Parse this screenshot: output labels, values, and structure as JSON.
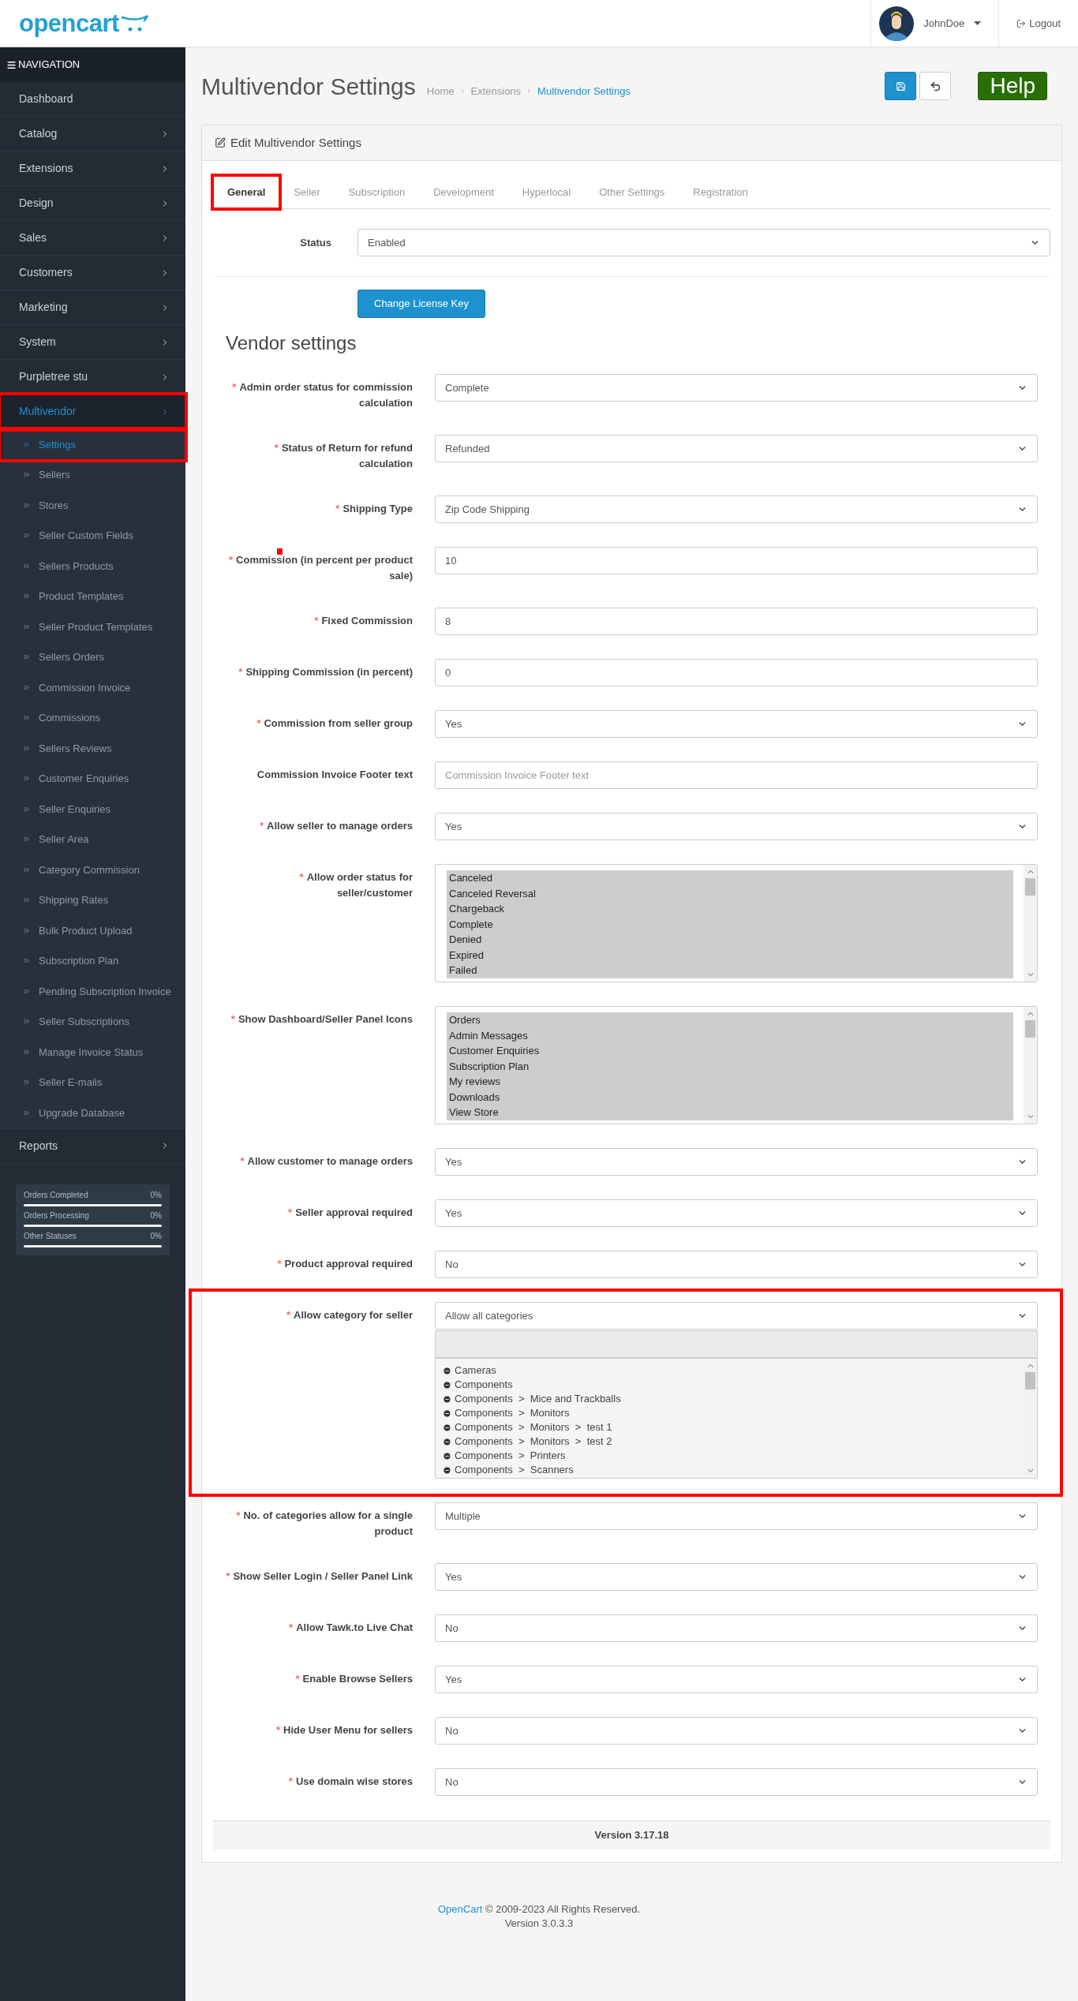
{
  "header": {
    "logo": "opencart",
    "user": "JohnDoe",
    "logout": "Logout"
  },
  "sidebar": {
    "heading": "NAVIGATION",
    "items": [
      {
        "label": "Dashboard",
        "has_children": false,
        "selected": false,
        "highlighted": false
      },
      {
        "label": "Catalog",
        "has_children": true,
        "selected": false,
        "highlighted": false
      },
      {
        "label": "Extensions",
        "has_children": true,
        "selected": false,
        "highlighted": false
      },
      {
        "label": "Design",
        "has_children": true,
        "selected": false,
        "highlighted": false
      },
      {
        "label": "Sales",
        "has_children": true,
        "selected": false,
        "highlighted": false
      },
      {
        "label": "Customers",
        "has_children": true,
        "selected": false,
        "highlighted": false
      },
      {
        "label": "Marketing",
        "has_children": true,
        "selected": false,
        "highlighted": false
      },
      {
        "label": "System",
        "has_children": true,
        "selected": false,
        "highlighted": false
      },
      {
        "label": "Purpletree stu",
        "has_children": true,
        "selected": false,
        "highlighted": false
      },
      {
        "label": "Multivendor",
        "has_children": true,
        "selected": true,
        "highlighted": true,
        "children": [
          {
            "label": "Settings",
            "selected": true,
            "highlighted": true
          },
          {
            "label": "Sellers",
            "selected": false,
            "highlighted": false
          },
          {
            "label": "Stores",
            "selected": false,
            "highlighted": false
          },
          {
            "label": "Seller Custom Fields",
            "selected": false,
            "highlighted": false
          },
          {
            "label": "Sellers Products",
            "selected": false,
            "highlighted": false
          },
          {
            "label": "Product Templates",
            "selected": false,
            "highlighted": false
          },
          {
            "label": "Seller Product Templates",
            "selected": false,
            "highlighted": false
          },
          {
            "label": "Sellers Orders",
            "selected": false,
            "highlighted": false
          },
          {
            "label": "Commission Invoice",
            "selected": false,
            "highlighted": false
          },
          {
            "label": "Commissions",
            "selected": false,
            "highlighted": false
          },
          {
            "label": "Sellers Reviews",
            "selected": false,
            "highlighted": false
          },
          {
            "label": "Customer Enquiries",
            "selected": false,
            "highlighted": false
          },
          {
            "label": "Seller Enquiries",
            "selected": false,
            "highlighted": false
          },
          {
            "label": "Seller Area",
            "selected": false,
            "highlighted": false
          },
          {
            "label": "Category Commission",
            "selected": false,
            "highlighted": false
          },
          {
            "label": "Shipping Rates",
            "selected": false,
            "highlighted": false
          },
          {
            "label": "Bulk Product Upload",
            "selected": false,
            "highlighted": false
          },
          {
            "label": "Subscription Plan",
            "selected": false,
            "highlighted": false
          },
          {
            "label": "Pending Subscription Invoice",
            "selected": false,
            "highlighted": false
          },
          {
            "label": "Seller Subscriptions",
            "selected": false,
            "highlighted": false
          },
          {
            "label": "Manage Invoice Status",
            "selected": false,
            "highlighted": false
          },
          {
            "label": "Seller E-mails",
            "selected": false,
            "highlighted": false
          },
          {
            "label": "Upgrade Database",
            "selected": false,
            "highlighted": false
          }
        ]
      },
      {
        "label": "Reports",
        "has_children": true,
        "selected": false,
        "highlighted": false
      }
    ],
    "stats": [
      {
        "label": "Orders Completed",
        "value": "0%",
        "level": 0
      },
      {
        "label": "Orders Processing",
        "value": "0%",
        "level": 0
      },
      {
        "label": "Other Statuses",
        "value": "0%",
        "level": 0
      }
    ]
  },
  "page": {
    "title": "Multivendor Settings",
    "breadcrumb": [
      {
        "label": "Home",
        "current": false
      },
      {
        "label": "Extensions",
        "current": false
      },
      {
        "label": "Multivendor Settings",
        "current": true
      }
    ],
    "help": "Help"
  },
  "panel": {
    "title": "Edit Multivendor Settings",
    "tabs": [
      {
        "label": "General",
        "selected": true,
        "highlighted": true
      },
      {
        "label": "Seller",
        "selected": false,
        "highlighted": false
      },
      {
        "label": "Subscription",
        "selected": false,
        "highlighted": false
      },
      {
        "label": "Development",
        "selected": false,
        "highlighted": false
      },
      {
        "label": "Hyperlocal",
        "selected": false,
        "highlighted": false
      },
      {
        "label": "Other Settings",
        "selected": false,
        "highlighted": false
      },
      {
        "label": "Registration",
        "selected": false,
        "highlighted": false
      }
    ],
    "status": {
      "label": "Status",
      "value": "Enabled"
    },
    "license_button": "Change License Key",
    "section_title": "Vendor settings",
    "fields": [
      {
        "kind": "select",
        "required_mark": "*",
        "label": "Admin order status for commission calculation",
        "value": "Complete",
        "highlighted": false,
        "marked": false
      },
      {
        "kind": "select",
        "required_mark": "*",
        "label": "Status of Return for refund calculation",
        "value": "Refunded",
        "highlighted": false,
        "marked": false
      },
      {
        "kind": "select",
        "required_mark": "*",
        "label": "Shipping Type",
        "value": "Zip Code Shipping",
        "highlighted": false,
        "marked": false
      },
      {
        "kind": "text",
        "required_mark": "*",
        "label": "Commission (in percent per product sale)",
        "value": "10",
        "highlighted": false,
        "marked": true
      },
      {
        "kind": "text",
        "required_mark": "*",
        "label": "Fixed Commission",
        "value": "8",
        "highlighted": false,
        "marked": false
      },
      {
        "kind": "text",
        "required_mark": "*",
        "label": "Shipping Commission (in percent)",
        "value": "0",
        "highlighted": false,
        "marked": false
      },
      {
        "kind": "select",
        "required_mark": "*",
        "label": "Commission from seller group",
        "value": "Yes",
        "highlighted": false,
        "marked": false
      },
      {
        "kind": "text",
        "label": "Commission Invoice Footer text",
        "placeholder": "Commission Invoice Footer text",
        "highlighted": false,
        "marked": false
      },
      {
        "kind": "select",
        "required_mark": "*",
        "label": "Allow seller to manage orders",
        "value": "Yes",
        "highlighted": false,
        "marked": false
      },
      {
        "kind": "multiselect",
        "required_mark": "*",
        "label": "Allow order status for seller/customer",
        "highlighted": false,
        "marked": false,
        "options": [
          {
            "label": "Canceled",
            "selected": true
          },
          {
            "label": "Canceled Reversal",
            "selected": true
          },
          {
            "label": "Chargeback",
            "selected": true
          },
          {
            "label": "Complete",
            "selected": true
          },
          {
            "label": "Denied",
            "selected": true
          },
          {
            "label": "Expired",
            "selected": true
          },
          {
            "label": "Failed",
            "selected": true
          }
        ]
      },
      {
        "kind": "multiselect",
        "required_mark": "*",
        "label": "Show Dashboard/Seller Panel Icons",
        "highlighted": false,
        "marked": false,
        "options": [
          {
            "label": "Orders",
            "selected": true
          },
          {
            "label": "Admin Messages",
            "selected": true
          },
          {
            "label": "Customer Enquiries",
            "selected": true
          },
          {
            "label": "Subscription Plan",
            "selected": true
          },
          {
            "label": "My reviews",
            "selected": true
          },
          {
            "label": "Downloads",
            "selected": true
          },
          {
            "label": "View Store",
            "selected": true
          }
        ]
      },
      {
        "kind": "select",
        "required_mark": "*",
        "label": "Allow customer to manage orders",
        "value": "Yes",
        "highlighted": false,
        "marked": false
      },
      {
        "kind": "select",
        "required_mark": "*",
        "label": "Seller approval required",
        "value": "Yes",
        "highlighted": false,
        "marked": false
      },
      {
        "kind": "select",
        "required_mark": "*",
        "label": "Product approval required",
        "value": "No",
        "highlighted": false,
        "marked": false
      },
      {
        "kind": "category",
        "required_mark": "*",
        "label": "Allow category for seller",
        "value": "Allow all categories",
        "highlighted": true,
        "marked": false,
        "options": [
          {
            "label": "Cameras"
          },
          {
            "label": "Components"
          },
          {
            "label": "Components  >  Mice and Trackballs"
          },
          {
            "label": "Components  >  Monitors"
          },
          {
            "label": "Components  >  Monitors  >  test 1"
          },
          {
            "label": "Components  >  Monitors  >  test 2"
          },
          {
            "label": "Components  >  Printers"
          },
          {
            "label": "Components  >  Scanners"
          }
        ]
      },
      {
        "kind": "select",
        "required_mark": "*",
        "label": "No. of categories allow for a single product",
        "value": "Multiple",
        "highlighted": false,
        "marked": false
      },
      {
        "kind": "select",
        "required_mark": "*",
        "label": "Show Seller Login / Seller Panel Link",
        "value": "Yes",
        "highlighted": false,
        "marked": false
      },
      {
        "kind": "select",
        "required_mark": "*",
        "label": "Allow Tawk.to Live Chat",
        "value": "No",
        "highlighted": false,
        "marked": false
      },
      {
        "kind": "select",
        "required_mark": "*",
        "label": "Enable Browse Sellers",
        "value": "Yes",
        "highlighted": false,
        "marked": false
      },
      {
        "kind": "select",
        "required_mark": "*",
        "label": "Hide User Menu for sellers",
        "value": "No",
        "highlighted": false,
        "marked": false
      },
      {
        "kind": "select",
        "required_mark": "*",
        "label": "Use domain wise stores",
        "value": "No",
        "highlighted": false,
        "marked": false
      }
    ],
    "version": "Version 3.17.18"
  },
  "footer": {
    "link": "OpenCart",
    "text": "© 2009-2023 All Rights Reserved.",
    "version": "Version 3.0.3.3"
  }
}
